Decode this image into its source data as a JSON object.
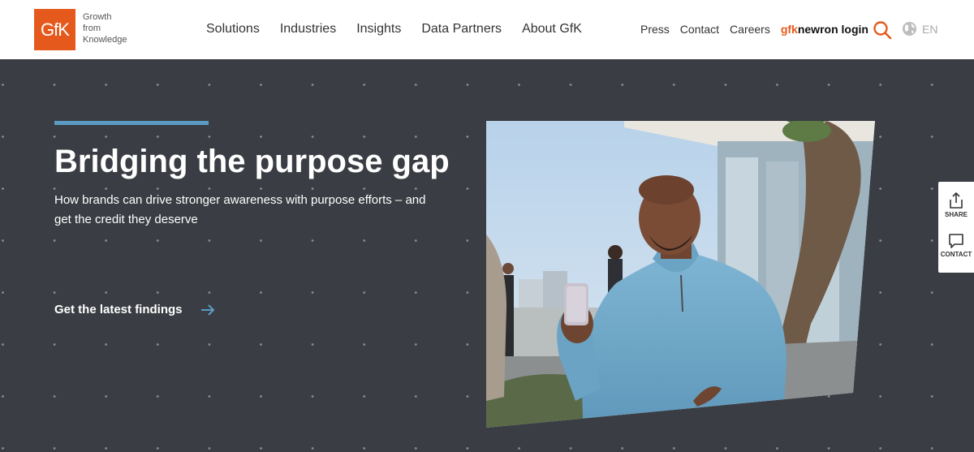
{
  "header": {
    "logo_text": "GfK",
    "tagline": [
      "Growth",
      "from",
      "Knowledge"
    ],
    "main_nav": [
      "Solutions",
      "Industries",
      "Insights",
      "Data Partners",
      "About GfK"
    ],
    "util_nav": [
      "Press",
      "Contact",
      "Careers"
    ],
    "login": {
      "brand": "gfk",
      "rest": "newron login"
    },
    "language": "EN",
    "search_icon": "search-icon",
    "globe_icon": "globe-icon"
  },
  "hero": {
    "title": "Bridging the purpose gap",
    "subtitle": "How brands can drive stronger awareness with purpose efforts – and get the credit they deserve",
    "cta": "Get the latest findings",
    "accent_color": "#5b9cc4",
    "background_color": "#3a3d43"
  },
  "side_tabs": {
    "share": "SHARE",
    "contact": "CONTACT"
  },
  "colors": {
    "brand_orange": "#e55a1c",
    "hero_bg": "#3a3d43",
    "accent_blue": "#5b9cc4"
  }
}
